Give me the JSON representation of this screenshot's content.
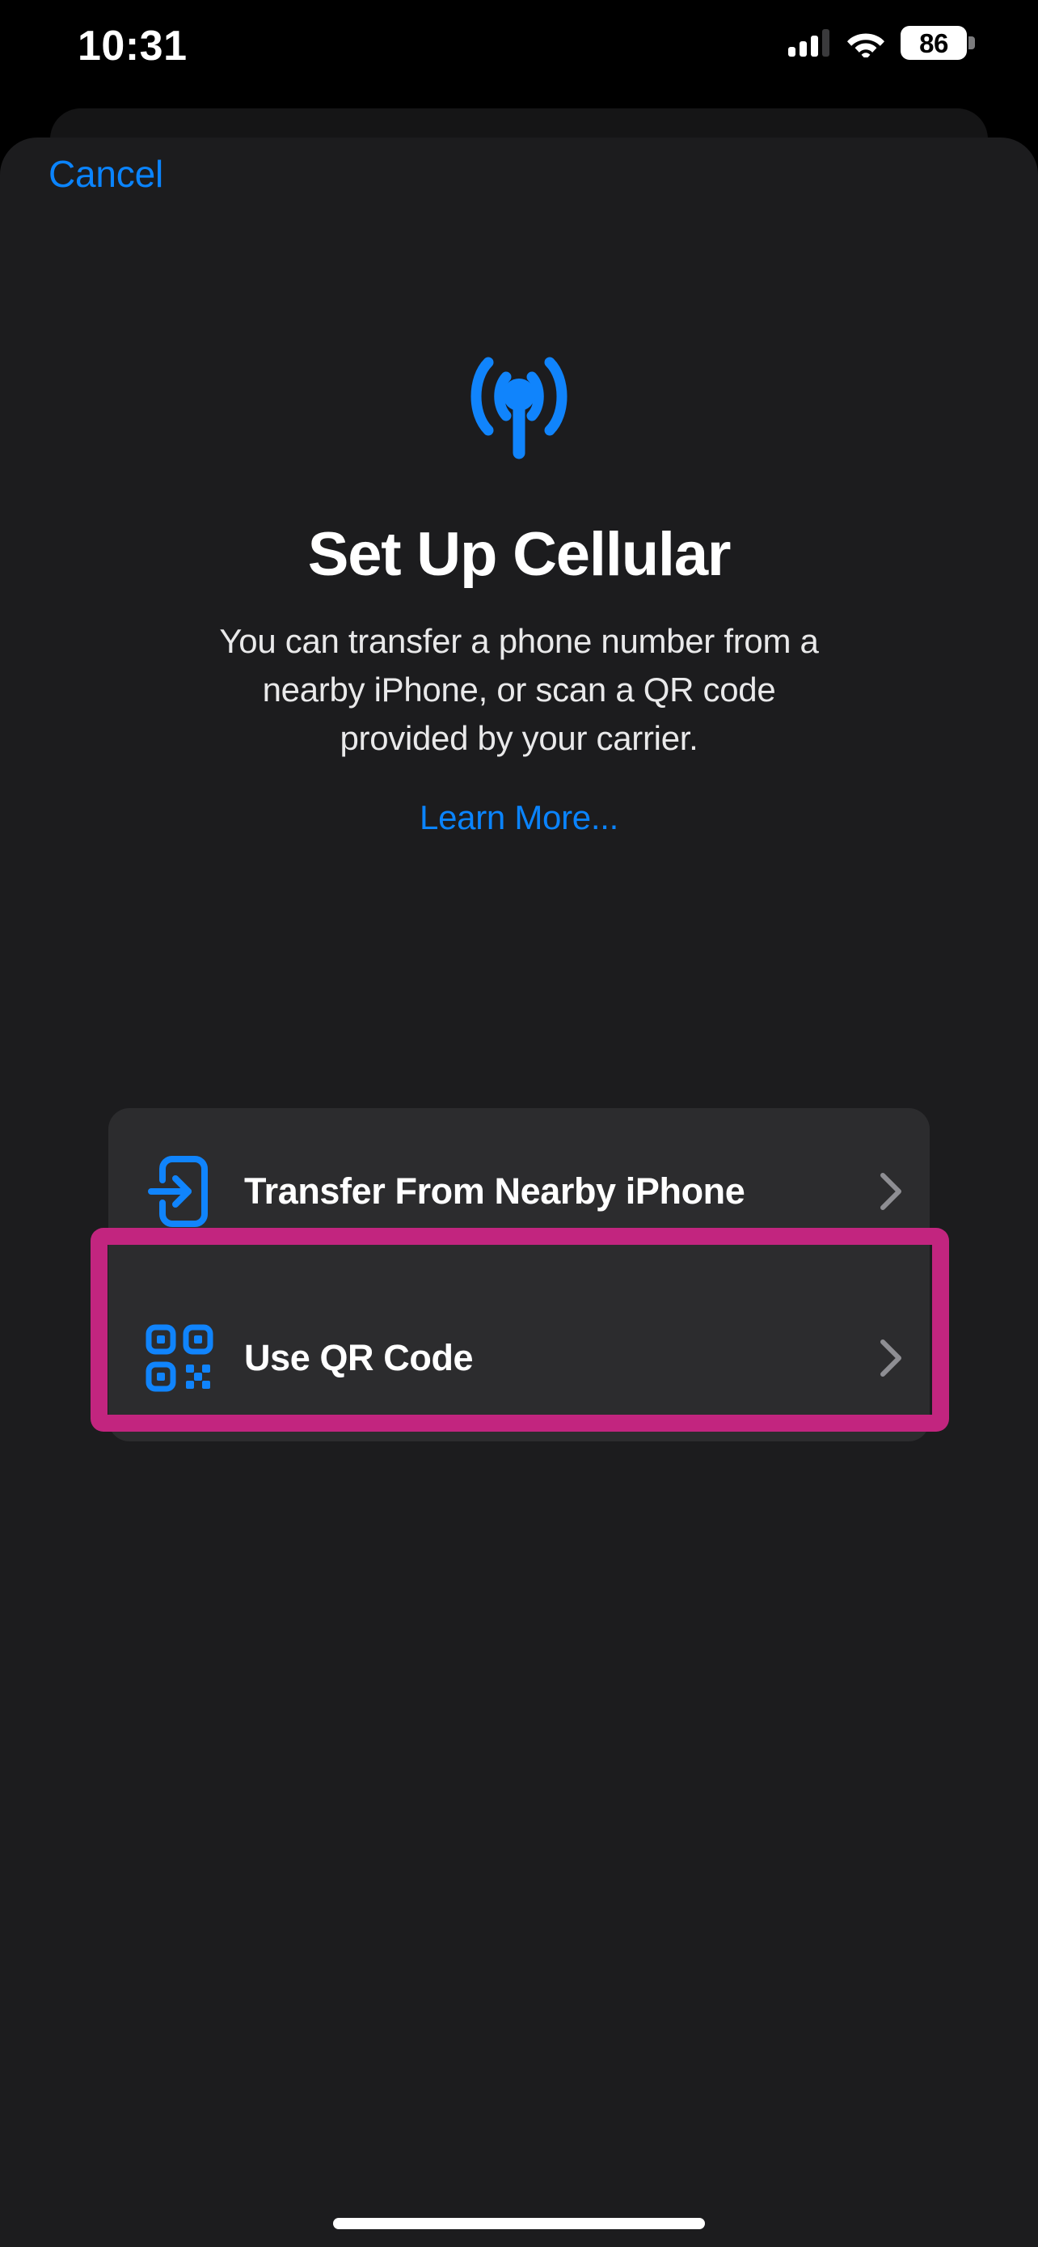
{
  "status_bar": {
    "time": "10:31",
    "cellular_icon": "cellular-signal-icon",
    "cellular_bars_active": 3,
    "cellular_bars_total": 4,
    "wifi_icon": "wifi-icon",
    "battery_icon": "battery-icon",
    "battery_level": "86"
  },
  "nav": {
    "cancel_label": "Cancel"
  },
  "hero": {
    "icon": "antenna-radiowaves-icon",
    "title": "Set Up Cellular",
    "description": "You can transfer a phone number from a nearby iPhone, or scan a QR code provided by your carrier.",
    "learn_more_label": "Learn More..."
  },
  "options": [
    {
      "icon": "iphone-arrow-forward-icon",
      "label": "Transfer From Nearby iPhone",
      "accessory": "chevron-right-icon"
    },
    {
      "icon": "qr-code-icon",
      "label": "Use QR Code",
      "accessory": "chevron-right-icon"
    }
  ],
  "highlight": {
    "target": "Use QR Code",
    "color": "#C2257F"
  },
  "colors": {
    "accent_blue": "#0A84FF",
    "sheet_background": "#1C1C1E",
    "row_background": "#2C2C2E",
    "highlight_magenta": "#C2257F",
    "text_primary": "#FFFFFF",
    "chevron_gray": "#8E8E93"
  }
}
